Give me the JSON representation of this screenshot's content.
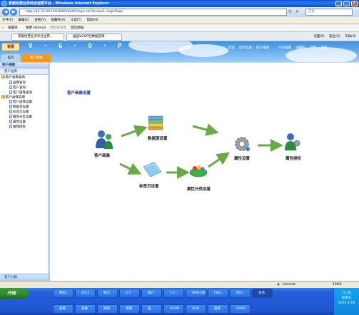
{
  "window": {
    "title": "客服经营业务综合运营平台 - Windows Internet Explorer",
    "minimize": "_",
    "maximize": "□",
    "close": "×"
  },
  "browser": {
    "address": "http://10.25.00.149:8080/VGOP/login.do?forward=loginPage",
    "search_placeholder": "百度",
    "menu": [
      "文件(F)",
      "编辑(E)",
      "查看(V)",
      "收藏夹(A)",
      "工具(T)",
      "帮助(H)"
    ],
    "favorites": [
      "收藏夹",
      "免费 Hotmail",
      "网页快讯库",
      "建议网站"
    ],
    "tabs": [
      "客服经营业务综合运营...",
      "画运VGOP社数据宣课"
    ],
    "tab_icons": [
      "页面(P)",
      "安全(S)",
      "工具(O)"
    ]
  },
  "app": {
    "logo": "客服",
    "brand": "V · G · O · P",
    "header_nav": [
      "您好,",
      "您的位置:",
      "客户视图"
    ],
    "header_links": [
      "今日提醒",
      "收藏夹",
      "帮助",
      "退出"
    ],
    "tabs": [
      "首页",
      "客户视图"
    ]
  },
  "sidebar": {
    "title": "客户视图",
    "section": "客户画像",
    "groups": [
      {
        "label": "客户画像查询",
        "items": [
          "画像查询",
          "客户查询",
          "客户属性查询"
        ]
      },
      {
        "label": "客户画像管理",
        "items": [
          "客户画像设置",
          "数据源设置",
          "标签页设置",
          "属性分类设置",
          "属性设置",
          "属性授权"
        ]
      }
    ],
    "footer": "客户分群"
  },
  "main": {
    "title": "客户画像设置",
    "nodes": {
      "profile": "客户画像",
      "datasource": "数据源设置",
      "tags": "标签页设置",
      "category": "属性分类设置",
      "attribute": "属性设置",
      "auth": "属性授权"
    }
  },
  "status": {
    "zone": "Internet",
    "zoom": "100%"
  },
  "taskbar": {
    "start": "开始",
    "row1": [
      "网页...",
      "2012...",
      "窗口",
      "3.5",
      "窗口",
      "5.2...",
      "WEB-INF",
      "Flex...",
      "Win..."
    ],
    "row2": [
      "金库",
      "金库",
      "测试",
      "地理",
      "画",
      "VGOP",
      "VGO",
      "金库",
      "VGOP"
    ],
    "row1_extra": "会话",
    "clock": "15:36",
    "weekday": "星期五",
    "date": "2012-2-24"
  },
  "colors": {
    "arrow": "#6aa94a",
    "title_blue": "#1a2aa0",
    "accent_orange": "#f09a22"
  }
}
